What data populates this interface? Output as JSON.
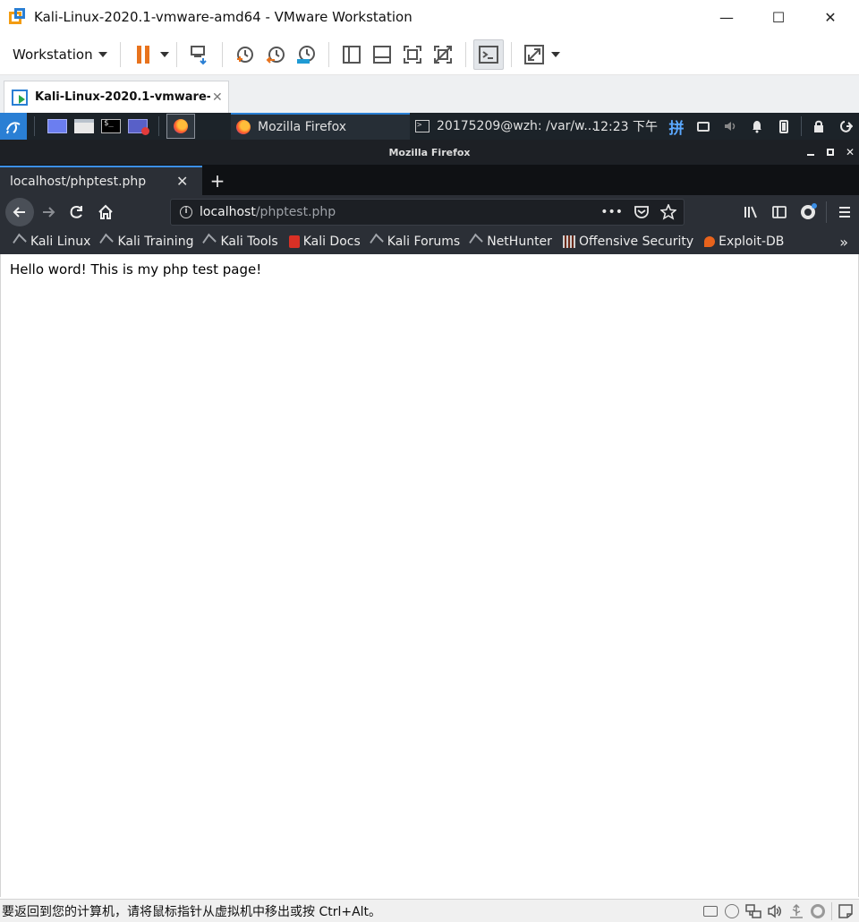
{
  "vmware": {
    "title": "Kali-Linux-2020.1-vmware-amd64 - VMware Workstation",
    "window_controls": {
      "minimize": "—",
      "maximize": "☐",
      "close": "✕"
    },
    "toolbar": {
      "menu_label": "Workstation"
    },
    "tab": {
      "label": "Kali-Linux-2020.1-vmware-a...",
      "close": "✕"
    },
    "statusbar": {
      "text": "要返回到您的计算机，请将鼠标指针从虚拟机中移出或按 Ctrl+Alt。"
    }
  },
  "kali_panel": {
    "tasks": [
      {
        "label": "Mozilla Firefox",
        "icon": "firefox-icon",
        "active": true
      },
      {
        "label": "20175209@wzh: /var/w...",
        "icon": "terminal-icon",
        "active": false
      }
    ],
    "clock": "12:23 下午",
    "input_method": "拼"
  },
  "firefox": {
    "window_title": "Mozilla Firefox",
    "tab": {
      "label": "localhost/phptest.php",
      "close": "✕"
    },
    "new_tab": "+",
    "url": {
      "host": "localhost",
      "path": "/phptest.php",
      "actions": "•••"
    },
    "bookmarks": [
      {
        "label": "Kali Linux",
        "icon": "kali-dragon-icon"
      },
      {
        "label": "Kali Training",
        "icon": "kali-dragon-icon"
      },
      {
        "label": "Kali Tools",
        "icon": "kali-dragon-icon"
      },
      {
        "label": "Kali Docs",
        "icon": "kali-docs-icon"
      },
      {
        "label": "Kali Forums",
        "icon": "kali-dragon-icon"
      },
      {
        "label": "NetHunter",
        "icon": "nethunter-icon"
      },
      {
        "label": "Offensive Security",
        "icon": "offsec-icon"
      },
      {
        "label": "Exploit-DB",
        "icon": "exploitdb-icon"
      }
    ],
    "bookmarks_more": "»",
    "page": {
      "text": "Hello word! This is my php test page!"
    }
  }
}
